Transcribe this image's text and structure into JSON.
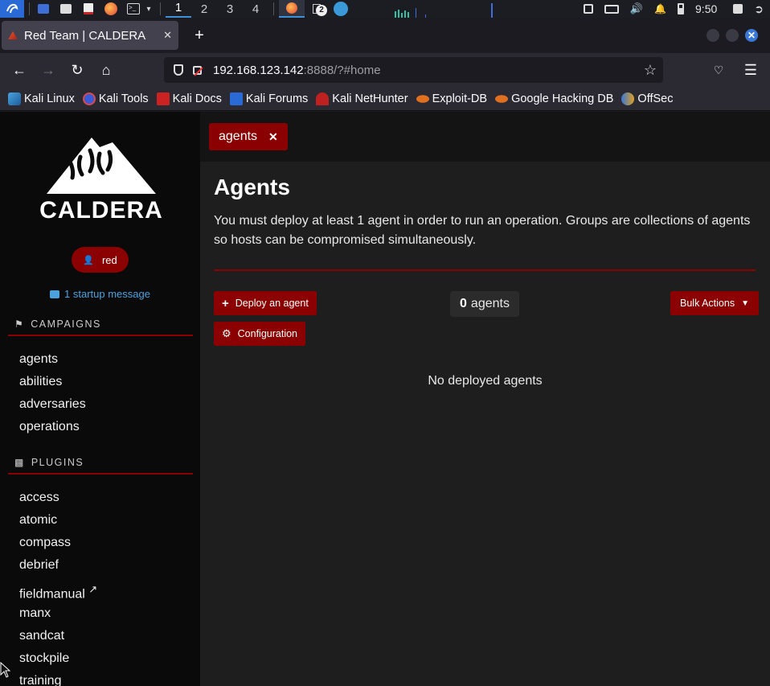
{
  "taskbar": {
    "workspaces": [
      "1",
      "2",
      "3",
      "4"
    ],
    "active_workspace": "1",
    "badge": "2",
    "clock": "9:50"
  },
  "browser": {
    "tab_title": "Red Team | CALDERA",
    "new_tab": "+",
    "close_tab": "✕",
    "url_host": "192.168.123.142",
    "url_rest": ":8888/?#home"
  },
  "bookmarks": [
    {
      "label": "Kali Linux",
      "color": "#4aa3df"
    },
    {
      "label": "Kali Tools",
      "color": "#d94a4a"
    },
    {
      "label": "Kali Docs",
      "color": "#cc2222"
    },
    {
      "label": "Kali Forums",
      "color": "#2a6ad6"
    },
    {
      "label": "Kali NetHunter",
      "color": "#c02020"
    },
    {
      "label": "Exploit-DB",
      "color": "#e07020"
    },
    {
      "label": "Google Hacking DB",
      "color": "#e07020"
    },
    {
      "label": "OffSec",
      "color": "#3a78d8"
    }
  ],
  "sidebar": {
    "logo_text": "CALDERA",
    "user": "red",
    "startup_message": "1 startup message",
    "campaigns_heading": "CAMPAIGNS",
    "campaigns": [
      "agents",
      "abilities",
      "adversaries",
      "operations"
    ],
    "plugins_heading": "PLUGINS",
    "plugins": [
      "access",
      "atomic",
      "compass",
      "debrief",
      "fieldmanual",
      "manx",
      "sandcat",
      "stockpile",
      "training"
    ]
  },
  "main": {
    "open_tab": "agents",
    "close_glyph": "✕",
    "title": "Agents",
    "description": "You must deploy at least 1 agent in order to run an operation. Groups are collections of agents so hosts can be compromised simultaneously.",
    "deploy_button": "Deploy an agent",
    "config_button": "Configuration",
    "agent_count": "0",
    "agent_count_label": "agents",
    "bulk_actions": "Bulk Actions",
    "empty_message": "No deployed agents"
  },
  "colors": {
    "accent": "#8b0000",
    "link": "#4aa3df",
    "sidebar_bg": "#0a0a0a",
    "main_bg": "#1e1e1e"
  }
}
